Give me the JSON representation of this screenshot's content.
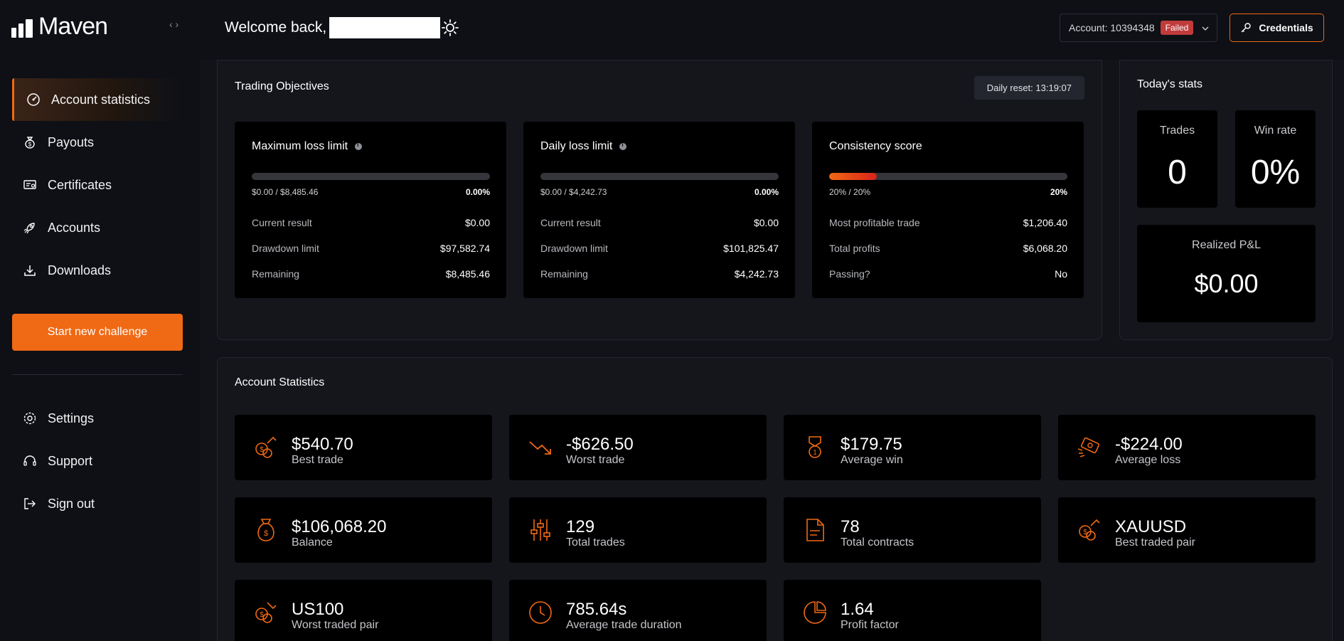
{
  "brand": {
    "name": "Maven"
  },
  "header": {
    "welcome": "Welcome back,",
    "account_label": "Account: 10394348",
    "account_status": "Failed",
    "credentials_label": "Credentials"
  },
  "sidebar": {
    "items": [
      {
        "label": "Account statistics",
        "icon": "gauge-icon"
      },
      {
        "label": "Payouts",
        "icon": "money-bag-icon"
      },
      {
        "label": "Certificates",
        "icon": "certificate-icon"
      },
      {
        "label": "Accounts",
        "icon": "rocket-icon"
      },
      {
        "label": "Downloads",
        "icon": "download-icon"
      }
    ],
    "start_button": "Start new challenge",
    "bottom_items": [
      {
        "label": "Settings",
        "icon": "gear-icon"
      },
      {
        "label": "Support",
        "icon": "headset-icon"
      },
      {
        "label": "Sign out",
        "icon": "sign-out-icon"
      }
    ]
  },
  "objectives": {
    "title": "Trading Objectives",
    "daily_reset": "Daily reset: 13:19:07",
    "cards": [
      {
        "title": "Maximum loss limit",
        "progress_text": "$0.00 / $8,485.46",
        "percent": "0.00%",
        "progress_fraction": 0,
        "rows": [
          {
            "label": "Current result",
            "value": "$0.00"
          },
          {
            "label": "Drawdown limit",
            "value": "$97,582.74"
          },
          {
            "label": "Remaining",
            "value": "$8,485.46"
          }
        ]
      },
      {
        "title": "Daily loss limit",
        "progress_text": "$0.00 / $4,242.73",
        "percent": "0.00%",
        "progress_fraction": 0,
        "rows": [
          {
            "label": "Current result",
            "value": "$0.00"
          },
          {
            "label": "Drawdown limit",
            "value": "$101,825.47"
          },
          {
            "label": "Remaining",
            "value": "$4,242.73"
          }
        ]
      },
      {
        "title": "Consistency score",
        "progress_text": "20% / 20%",
        "percent": "20%",
        "progress_fraction": 0.2,
        "rows": [
          {
            "label": "Most profitable trade",
            "value": "$1,206.40"
          },
          {
            "label": "Total profits",
            "value": "$6,068.20"
          },
          {
            "label": "Passing?",
            "value": "No"
          }
        ]
      }
    ]
  },
  "today": {
    "title": "Today's stats",
    "trades_label": "Trades",
    "trades_value": "0",
    "winrate_label": "Win rate",
    "winrate_value": "0%",
    "pnl_label": "Realized P&L",
    "pnl_value": "$0.00"
  },
  "account_stats": {
    "title": "Account Statistics",
    "items": [
      {
        "value": "$540.70",
        "label": "Best trade",
        "icon": "coins-up-icon"
      },
      {
        "value": "-$626.50",
        "label": "Worst trade",
        "icon": "trend-down-icon"
      },
      {
        "value": "$179.75",
        "label": "Average win",
        "icon": "medal-icon"
      },
      {
        "value": "-$224.00",
        "label": "Average loss",
        "icon": "money-fly-icon"
      },
      {
        "value": "$106,068.20",
        "label": "Balance",
        "icon": "money-bag-icon"
      },
      {
        "value": "129",
        "label": "Total trades",
        "icon": "sliders-icon"
      },
      {
        "value": "78",
        "label": "Total contracts",
        "icon": "document-icon"
      },
      {
        "value": "XAUUSD",
        "label": "Best traded pair",
        "icon": "coins-up-icon"
      },
      {
        "value": "US100",
        "label": "Worst traded pair",
        "icon": "coins-down-icon"
      },
      {
        "value": "785.64s",
        "label": "Average trade duration",
        "icon": "clock-icon"
      },
      {
        "value": "1.64",
        "label": "Profit factor",
        "icon": "pie-chart-icon"
      }
    ]
  },
  "colors": {
    "accent": "#f06914",
    "failed": "#c13b3b",
    "background": "#0e1016"
  }
}
